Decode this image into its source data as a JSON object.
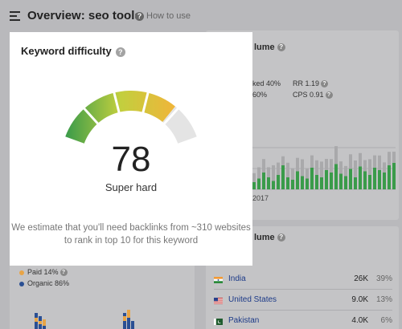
{
  "header": {
    "title": "Overview: seo tools",
    "help_link": "How to use"
  },
  "volume_card": {
    "title_fragment": "lume",
    "clicks_fragment": "ked 40%",
    "pct_fragment": "60%",
    "rr": "RR 1.19",
    "cps": "CPS 0.91",
    "year_label": "2017"
  },
  "countries_card": {
    "title_fragment": "lume",
    "rows": [
      {
        "country": "India",
        "volume": "26K",
        "percent": "39%",
        "flag_icon": "india-flag-icon"
      },
      {
        "country": "United States",
        "volume": "9.0K",
        "percent": "13%",
        "flag_icon": "us-flag-icon"
      },
      {
        "country": "Pakistan",
        "volume": "4.0K",
        "percent": "6%",
        "flag_icon": "pakistan-flag-icon"
      }
    ]
  },
  "traffic_card": {
    "legend": [
      {
        "label": "Paid 14%",
        "color": "#e8a446"
      },
      {
        "label": "Organic 86%",
        "color": "#2a4f93"
      }
    ]
  },
  "keyword_difficulty": {
    "title": "Keyword difficulty",
    "score": "78",
    "score_value": 78,
    "label": "Super hard",
    "description": "We estimate that you'll need backlinks from ~310 websites to rank in top 10 for this keyword"
  },
  "colors": {
    "gauge_low": "#3a9b4a",
    "gauge_mid": "#c2cf3e",
    "gauge_high": "#f0b53a",
    "gauge_empty": "#e4e4e4",
    "bar_green": "#3a9b4a",
    "bar_grey": "#a9a9ab"
  }
}
